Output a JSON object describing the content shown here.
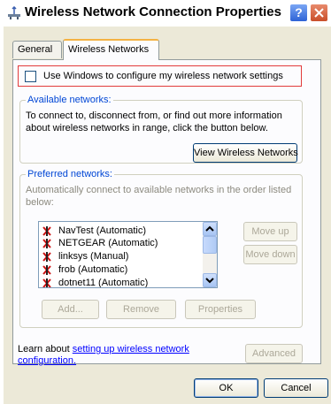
{
  "window": {
    "title": "Wireless Network Connection Properties"
  },
  "titlebar": {
    "help_label": "?"
  },
  "tabs": [
    {
      "label": "General"
    },
    {
      "label": "Wireless Networks"
    }
  ],
  "use_windows": {
    "label": "Use Windows to configure my wireless network settings",
    "checked": false
  },
  "available": {
    "title": "Available networks:",
    "description": "To connect to, disconnect from, or find out more information about wireless networks in range, click the button below.",
    "view_button": "View Wireless Networks"
  },
  "preferred": {
    "title": "Preferred networks:",
    "description": "Automatically connect to available networks in the order listed below:",
    "networks": [
      {
        "label": "NavTest (Automatic)",
        "icon": "wireless-antenna-icon"
      },
      {
        "label": "NETGEAR (Automatic)",
        "icon": "wireless-antenna-icon"
      },
      {
        "label": "linksys (Manual)",
        "icon": "wireless-antenna-icon"
      },
      {
        "label": "frob (Automatic)",
        "icon": "wireless-antenna-icon"
      },
      {
        "label": "dotnet11 (Automatic)",
        "icon": "wireless-antenna-icon"
      }
    ],
    "move_up": "Move up",
    "move_down": "Move down",
    "add": "Add...",
    "remove": "Remove",
    "properties": "Properties"
  },
  "learn": {
    "prefix": "Learn about ",
    "link": "setting up wireless network configuration."
  },
  "advanced": "Advanced",
  "ok": "OK",
  "cancel": "Cancel",
  "colors": {
    "accent": "#0046d5",
    "highlight_border": "#e23b3b",
    "tab_accent": "#f4b243"
  }
}
